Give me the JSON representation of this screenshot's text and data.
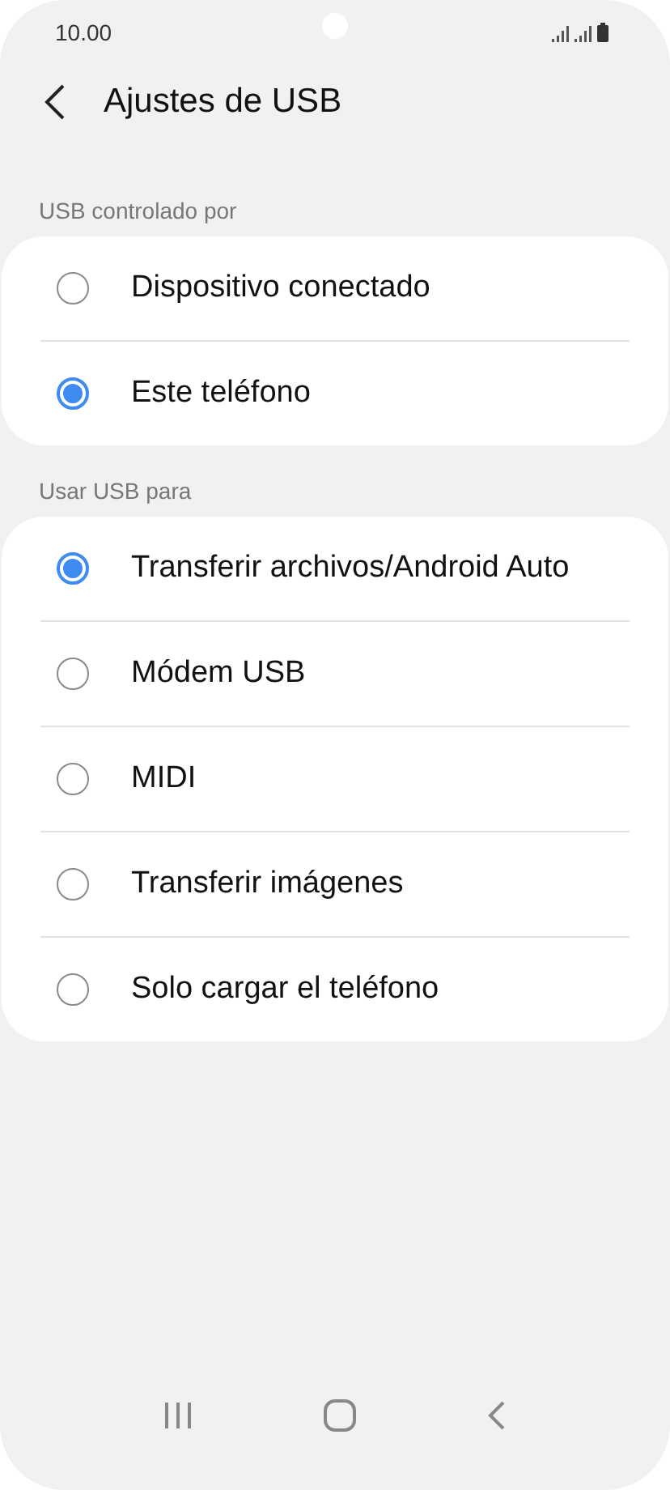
{
  "status_bar": {
    "time": "10.00"
  },
  "header": {
    "title": "Ajustes de USB"
  },
  "sections": [
    {
      "title": "USB controlado por",
      "options": [
        {
          "label": "Dispositivo conectado",
          "selected": false
        },
        {
          "label": "Este teléfono",
          "selected": true
        }
      ]
    },
    {
      "title": "Usar USB para",
      "options": [
        {
          "label": "Transferir archivos/Android Auto",
          "selected": true
        },
        {
          "label": "Módem USB",
          "selected": false
        },
        {
          "label": "MIDI",
          "selected": false
        },
        {
          "label": "Transferir imágenes",
          "selected": false
        },
        {
          "label": "Solo cargar el teléfono",
          "selected": false
        }
      ]
    }
  ]
}
